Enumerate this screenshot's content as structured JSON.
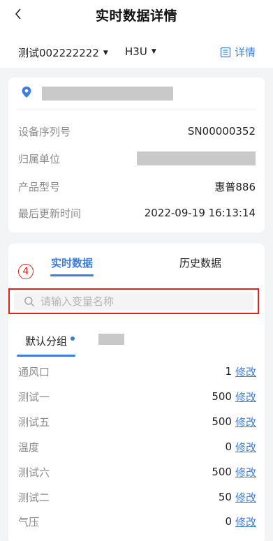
{
  "header": {
    "title": "实时数据详情",
    "device_select": "测试002222222",
    "model_select": "H3U",
    "detail_link": "详情"
  },
  "info": {
    "location_value": "",
    "rows": [
      {
        "label": "设备序列号",
        "value": "SN00000352"
      },
      {
        "label": "归属单位",
        "value": ""
      },
      {
        "label": "产品型号",
        "value": "惠普886"
      },
      {
        "label": "最后更新时间",
        "value": "2022-09-19 16:13:14"
      }
    ]
  },
  "data_panel": {
    "step_marker": "4",
    "tabs": [
      {
        "label": "实时数据",
        "active": true
      },
      {
        "label": "历史数据",
        "active": false
      }
    ],
    "search": {
      "placeholder": "请输入变量名称",
      "value": ""
    },
    "groups": [
      {
        "label": "默认分组",
        "active": true
      },
      {
        "label": "",
        "active": false
      }
    ],
    "edit_label": "修改",
    "variables": [
      {
        "name": "通风口",
        "value": "1"
      },
      {
        "name": "测试一",
        "value": "500"
      },
      {
        "name": "测试五",
        "value": "500"
      },
      {
        "name": "温度",
        "value": "0"
      },
      {
        "name": "测试六",
        "value": "500"
      },
      {
        "name": "测试二",
        "value": "50"
      },
      {
        "name": "气压",
        "value": "0"
      }
    ]
  },
  "colors": {
    "accent": "#3b7ee0",
    "highlight_red": "#e2231a",
    "redaction_gray": "#c9c9c9"
  },
  "icons": {
    "back": "chevron-left-icon",
    "dropdown": "caret-down-icon",
    "detail": "list-doc-icon",
    "location": "map-pin-icon",
    "search": "search-icon"
  }
}
